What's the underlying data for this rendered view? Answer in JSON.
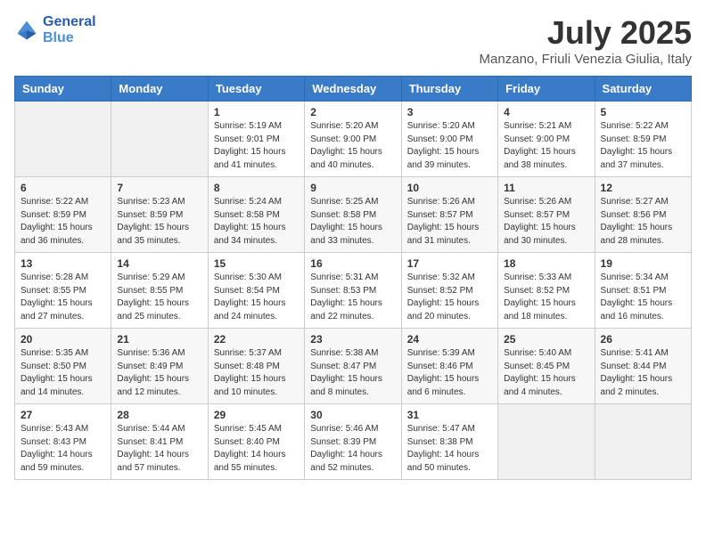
{
  "logo": {
    "line1": "General",
    "line2": "Blue"
  },
  "title": "July 2025",
  "location": "Manzano, Friuli Venezia Giulia, Italy",
  "days_of_week": [
    "Sunday",
    "Monday",
    "Tuesday",
    "Wednesday",
    "Thursday",
    "Friday",
    "Saturday"
  ],
  "weeks": [
    [
      {
        "day": "",
        "info": ""
      },
      {
        "day": "",
        "info": ""
      },
      {
        "day": "1",
        "info": "Sunrise: 5:19 AM\nSunset: 9:01 PM\nDaylight: 15 hours and 41 minutes."
      },
      {
        "day": "2",
        "info": "Sunrise: 5:20 AM\nSunset: 9:00 PM\nDaylight: 15 hours and 40 minutes."
      },
      {
        "day": "3",
        "info": "Sunrise: 5:20 AM\nSunset: 9:00 PM\nDaylight: 15 hours and 39 minutes."
      },
      {
        "day": "4",
        "info": "Sunrise: 5:21 AM\nSunset: 9:00 PM\nDaylight: 15 hours and 38 minutes."
      },
      {
        "day": "5",
        "info": "Sunrise: 5:22 AM\nSunset: 8:59 PM\nDaylight: 15 hours and 37 minutes."
      }
    ],
    [
      {
        "day": "6",
        "info": "Sunrise: 5:22 AM\nSunset: 8:59 PM\nDaylight: 15 hours and 36 minutes."
      },
      {
        "day": "7",
        "info": "Sunrise: 5:23 AM\nSunset: 8:59 PM\nDaylight: 15 hours and 35 minutes."
      },
      {
        "day": "8",
        "info": "Sunrise: 5:24 AM\nSunset: 8:58 PM\nDaylight: 15 hours and 34 minutes."
      },
      {
        "day": "9",
        "info": "Sunrise: 5:25 AM\nSunset: 8:58 PM\nDaylight: 15 hours and 33 minutes."
      },
      {
        "day": "10",
        "info": "Sunrise: 5:26 AM\nSunset: 8:57 PM\nDaylight: 15 hours and 31 minutes."
      },
      {
        "day": "11",
        "info": "Sunrise: 5:26 AM\nSunset: 8:57 PM\nDaylight: 15 hours and 30 minutes."
      },
      {
        "day": "12",
        "info": "Sunrise: 5:27 AM\nSunset: 8:56 PM\nDaylight: 15 hours and 28 minutes."
      }
    ],
    [
      {
        "day": "13",
        "info": "Sunrise: 5:28 AM\nSunset: 8:55 PM\nDaylight: 15 hours and 27 minutes."
      },
      {
        "day": "14",
        "info": "Sunrise: 5:29 AM\nSunset: 8:55 PM\nDaylight: 15 hours and 25 minutes."
      },
      {
        "day": "15",
        "info": "Sunrise: 5:30 AM\nSunset: 8:54 PM\nDaylight: 15 hours and 24 minutes."
      },
      {
        "day": "16",
        "info": "Sunrise: 5:31 AM\nSunset: 8:53 PM\nDaylight: 15 hours and 22 minutes."
      },
      {
        "day": "17",
        "info": "Sunrise: 5:32 AM\nSunset: 8:52 PM\nDaylight: 15 hours and 20 minutes."
      },
      {
        "day": "18",
        "info": "Sunrise: 5:33 AM\nSunset: 8:52 PM\nDaylight: 15 hours and 18 minutes."
      },
      {
        "day": "19",
        "info": "Sunrise: 5:34 AM\nSunset: 8:51 PM\nDaylight: 15 hours and 16 minutes."
      }
    ],
    [
      {
        "day": "20",
        "info": "Sunrise: 5:35 AM\nSunset: 8:50 PM\nDaylight: 15 hours and 14 minutes."
      },
      {
        "day": "21",
        "info": "Sunrise: 5:36 AM\nSunset: 8:49 PM\nDaylight: 15 hours and 12 minutes."
      },
      {
        "day": "22",
        "info": "Sunrise: 5:37 AM\nSunset: 8:48 PM\nDaylight: 15 hours and 10 minutes."
      },
      {
        "day": "23",
        "info": "Sunrise: 5:38 AM\nSunset: 8:47 PM\nDaylight: 15 hours and 8 minutes."
      },
      {
        "day": "24",
        "info": "Sunrise: 5:39 AM\nSunset: 8:46 PM\nDaylight: 15 hours and 6 minutes."
      },
      {
        "day": "25",
        "info": "Sunrise: 5:40 AM\nSunset: 8:45 PM\nDaylight: 15 hours and 4 minutes."
      },
      {
        "day": "26",
        "info": "Sunrise: 5:41 AM\nSunset: 8:44 PM\nDaylight: 15 hours and 2 minutes."
      }
    ],
    [
      {
        "day": "27",
        "info": "Sunrise: 5:43 AM\nSunset: 8:43 PM\nDaylight: 14 hours and 59 minutes."
      },
      {
        "day": "28",
        "info": "Sunrise: 5:44 AM\nSunset: 8:41 PM\nDaylight: 14 hours and 57 minutes."
      },
      {
        "day": "29",
        "info": "Sunrise: 5:45 AM\nSunset: 8:40 PM\nDaylight: 14 hours and 55 minutes."
      },
      {
        "day": "30",
        "info": "Sunrise: 5:46 AM\nSunset: 8:39 PM\nDaylight: 14 hours and 52 minutes."
      },
      {
        "day": "31",
        "info": "Sunrise: 5:47 AM\nSunset: 8:38 PM\nDaylight: 14 hours and 50 minutes."
      },
      {
        "day": "",
        "info": ""
      },
      {
        "day": "",
        "info": ""
      }
    ]
  ]
}
